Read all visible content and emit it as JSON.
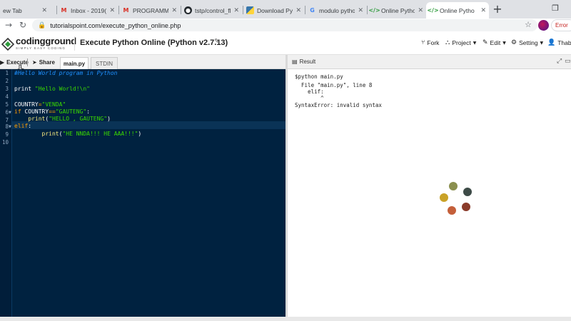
{
  "browser": {
    "tabs": [
      {
        "label": "ew Tab",
        "favicon": "blank-icon",
        "active": false
      },
      {
        "label": "Inbox - 2019(",
        "favicon": "gmail-icon",
        "active": false
      },
      {
        "label": "PROGRAMMI",
        "favicon": "gmail-icon",
        "active": false
      },
      {
        "label": "tstp/control_fl",
        "favicon": "github-icon",
        "active": false
      },
      {
        "label": "Download Pyt",
        "favicon": "python-icon",
        "active": false
      },
      {
        "label": "modulo pytho",
        "favicon": "google-icon",
        "active": false
      },
      {
        "label": "Online Pytho",
        "favicon": "code-icon",
        "active": false
      },
      {
        "label": "Online Pytho",
        "favicon": "code-icon",
        "active": true
      }
    ],
    "new_tab_symbol": "+",
    "url": "tutorialspoint.com/execute_python_online.php",
    "error_label": "Error"
  },
  "site": {
    "logo_word": "codingground",
    "logo_tagline": "SIMPLY EASY CODING",
    "page_title": "Execute Python Online (Python v2.7.13)",
    "menu": [
      {
        "label": "Fork",
        "icon": "fork-icon"
      },
      {
        "label": "Project",
        "icon": "project-icon",
        "dropdown": true
      },
      {
        "label": "Edit",
        "icon": "edit-icon",
        "dropdown": true
      },
      {
        "label": "Setting",
        "icon": "gear-icon",
        "dropdown": true
      },
      {
        "label": "Thabe",
        "icon": "user-icon"
      }
    ]
  },
  "toolbar": {
    "execute_label": "Execute",
    "share_label": "Share",
    "file_tab": "main.py",
    "stdin_tab": "STDIN"
  },
  "editor": {
    "line_numbers": [
      "1",
      "2",
      "3",
      "4",
      "5",
      "6",
      "7",
      "8",
      "9",
      "10"
    ],
    "lines": [
      "#Hello World program in Python",
      "",
      "print \"Hello World!\\n\"",
      "",
      "COUNTRY=\"VENDA\"",
      "if COUNTRY==\"GAUTENG\":",
      "    print(\"HELLO , GAUTENG\")",
      "elif:",
      "        print(\"HE NNDA!!! HE AAA!!!\")",
      ""
    ],
    "highlighted_line": 8
  },
  "result": {
    "title": "Result",
    "output_lines": [
      "$python main.py",
      "  File \"main.py\", line 8",
      "    elif:",
      "        ^",
      "SyntaxError: invalid syntax"
    ]
  },
  "colors": {
    "editor_bg": "#002240",
    "gutter_bg": "#011e3a",
    "comment": "#1e90ff",
    "keyword": "#ff9d00",
    "string": "#3ad900",
    "function": "#ffee80",
    "spinner": [
      "#8a8f4e",
      "#3d4b47",
      "#8a3b2a",
      "#c45f3a",
      "#c9a227"
    ]
  },
  "spinner_label": "loading-spinner"
}
